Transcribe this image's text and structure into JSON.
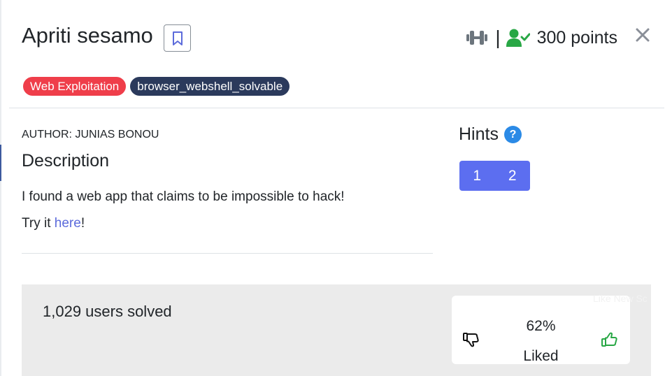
{
  "challenge": {
    "title": "Apriti sesamo",
    "points": "300 points",
    "separator": "|",
    "tags": [
      "Web Exploitation",
      "browser_webshell_solvable"
    ],
    "author": "AUTHOR: JUNIAS BONOU",
    "description_heading": "Description",
    "description_line1": "I found a web app that claims to be impossible to hack!",
    "description_line2_prefix": "Try it ",
    "description_link": "here",
    "description_line2_suffix": "!"
  },
  "hints": {
    "title": "Hints",
    "help": "?",
    "buttons": [
      "1",
      "2"
    ]
  },
  "stats": {
    "solved": "1,029 users solved",
    "liked_percent": "62%",
    "liked_label": "Liked"
  },
  "ghost_text": "Like  New Sc",
  "colors": {
    "category_tag": "#ef3e4a",
    "dark_tag": "#2b3a5c",
    "hint_button": "#5c6ef0",
    "help_icon": "#2b8ae6",
    "solved_icon": "#28a745",
    "link": "#5c6bdb"
  },
  "icons": {
    "bookmark": "bookmark-icon",
    "difficulty": "dumbbell-icon",
    "solved": "user-check-icon",
    "close": "close-icon",
    "dislike": "thumbs-down-icon",
    "like": "thumbs-up-icon"
  }
}
